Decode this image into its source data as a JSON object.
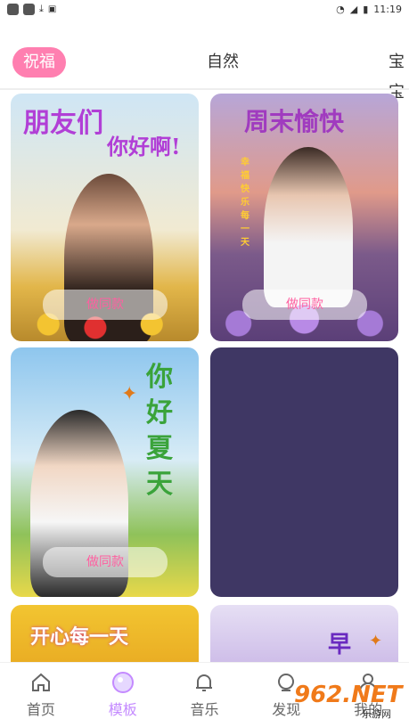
{
  "status": {
    "time": "11:19"
  },
  "tabs": [
    {
      "label": "祝福",
      "active": true
    },
    {
      "label": "自然",
      "active": false
    },
    {
      "label": "宝宝",
      "active": false
    }
  ],
  "cards": [
    {
      "title_line1": "朋友们",
      "title_line2": "你好啊!",
      "button": "做同款"
    },
    {
      "title": "周末愉快",
      "subtitle": "幸福快乐每一天",
      "button": "做同款"
    },
    {
      "title": "你好夏天",
      "button": "做同款"
    },
    {
      "title": "开心每一天"
    },
    {
      "title": "早"
    }
  ],
  "nav": [
    {
      "label": "首页",
      "icon": "home-icon",
      "active": false
    },
    {
      "label": "模板",
      "icon": "template-icon",
      "active": true
    },
    {
      "label": "音乐",
      "icon": "bell-icon",
      "active": false
    },
    {
      "label": "发现",
      "icon": "discover-icon",
      "active": false
    },
    {
      "label": "我的",
      "icon": "user-icon",
      "active": false
    }
  ],
  "watermark": {
    "text": "962.NET",
    "sub": "乐游网"
  },
  "colors": {
    "accent": "#ff7fb0",
    "nav_active": "#c48aff",
    "placeholder_card": "#3f3764"
  }
}
